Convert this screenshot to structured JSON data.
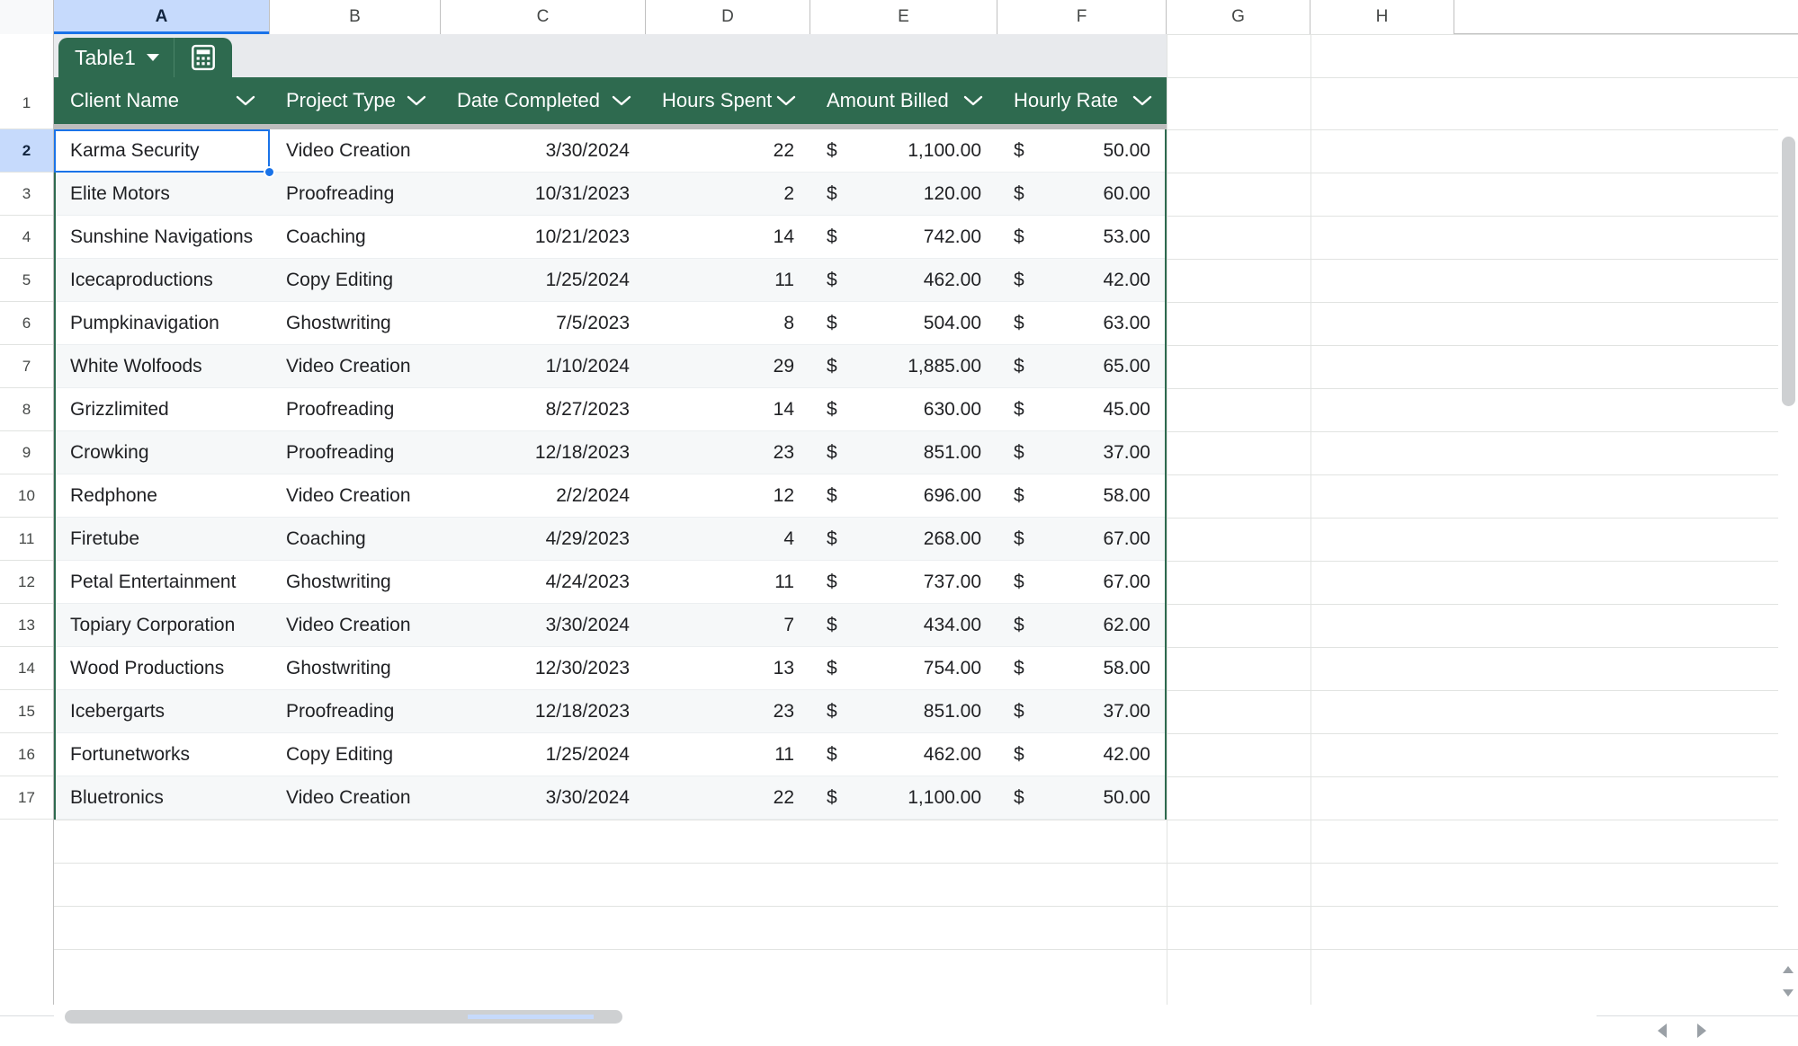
{
  "spreadsheet": {
    "column_headers": [
      "A",
      "B",
      "C",
      "D",
      "E",
      "F",
      "G",
      "H"
    ],
    "selected_column": "A",
    "selected_cell": "A2",
    "row_numbers": [
      "1",
      "2",
      "3",
      "4",
      "5",
      "6",
      "7",
      "8",
      "9",
      "10",
      "11",
      "12",
      "13",
      "14",
      "15",
      "16",
      "17"
    ],
    "selected_row": "2",
    "accent_color": "#1a73e8",
    "table_color": "#2e6a4f",
    "header_select_color": "#c6dafc"
  },
  "table": {
    "name": "Table1",
    "name_chevron_icon": "chevron-down-icon",
    "tools_icon": "table-calculate-icon",
    "columns": [
      {
        "label": "Client Name",
        "filter_icon": "chevron-down-icon",
        "align": "left"
      },
      {
        "label": "Project Type",
        "filter_icon": "chevron-down-icon",
        "align": "left"
      },
      {
        "label": "Date Completed",
        "filter_icon": "chevron-down-icon",
        "align": "right"
      },
      {
        "label": "Hours Spent",
        "filter_icon": "chevron-down-icon",
        "align": "right"
      },
      {
        "label": "Amount Billed",
        "filter_icon": "chevron-down-icon",
        "align": "money"
      },
      {
        "label": "Hourly Rate",
        "filter_icon": "chevron-down-icon",
        "align": "money"
      }
    ],
    "currency_symbol": "$",
    "rows": [
      {
        "client": "Karma Security",
        "project": "Video Creation",
        "date": "3/30/2024",
        "hours": "22",
        "amount": "1,100.00",
        "rate": "50.00"
      },
      {
        "client": "Elite Motors",
        "project": "Proofreading",
        "date": "10/31/2023",
        "hours": "2",
        "amount": "120.00",
        "rate": "60.00"
      },
      {
        "client": "Sunshine Navigations",
        "project": "Coaching",
        "date": "10/21/2023",
        "hours": "14",
        "amount": "742.00",
        "rate": "53.00"
      },
      {
        "client": "Icecaproductions",
        "project": "Copy Editing",
        "date": "1/25/2024",
        "hours": "11",
        "amount": "462.00",
        "rate": "42.00"
      },
      {
        "client": "Pumpkinavigation",
        "project": "Ghostwriting",
        "date": "7/5/2023",
        "hours": "8",
        "amount": "504.00",
        "rate": "63.00"
      },
      {
        "client": "White Wolfoods",
        "project": "Video Creation",
        "date": "1/10/2024",
        "hours": "29",
        "amount": "1,885.00",
        "rate": "65.00"
      },
      {
        "client": "Grizzlimited",
        "project": "Proofreading",
        "date": "8/27/2023",
        "hours": "14",
        "amount": "630.00",
        "rate": "45.00"
      },
      {
        "client": "Crowking",
        "project": "Proofreading",
        "date": "12/18/2023",
        "hours": "23",
        "amount": "851.00",
        "rate": "37.00"
      },
      {
        "client": "Redphone",
        "project": "Video Creation",
        "date": "2/2/2024",
        "hours": "12",
        "amount": "696.00",
        "rate": "58.00"
      },
      {
        "client": "Firetube",
        "project": "Coaching",
        "date": "4/29/2023",
        "hours": "4",
        "amount": "268.00",
        "rate": "67.00"
      },
      {
        "client": "Petal Entertainment",
        "project": "Ghostwriting",
        "date": "4/24/2023",
        "hours": "11",
        "amount": "737.00",
        "rate": "67.00"
      },
      {
        "client": "Topiary Corporation",
        "project": "Video Creation",
        "date": "3/30/2024",
        "hours": "7",
        "amount": "434.00",
        "rate": "62.00"
      },
      {
        "client": "Wood Productions",
        "project": "Ghostwriting",
        "date": "12/30/2023",
        "hours": "13",
        "amount": "754.00",
        "rate": "58.00"
      },
      {
        "client": "Icebergarts",
        "project": "Proofreading",
        "date": "12/18/2023",
        "hours": "23",
        "amount": "851.00",
        "rate": "37.00"
      },
      {
        "client": "Fortunetworks",
        "project": "Copy Editing",
        "date": "1/25/2024",
        "hours": "11",
        "amount": "462.00",
        "rate": "42.00"
      },
      {
        "client": "Bluetronics",
        "project": "Video Creation",
        "date": "3/30/2024",
        "hours": "22",
        "amount": "1,100.00",
        "rate": "50.00"
      }
    ]
  },
  "scrollbars": {
    "h_left_arrow_icon": "triangle-left-icon",
    "h_right_arrow_icon": "triangle-right-icon",
    "v_up_arrow_icon": "triangle-up-icon",
    "v_down_arrow_icon": "triangle-down-icon"
  }
}
